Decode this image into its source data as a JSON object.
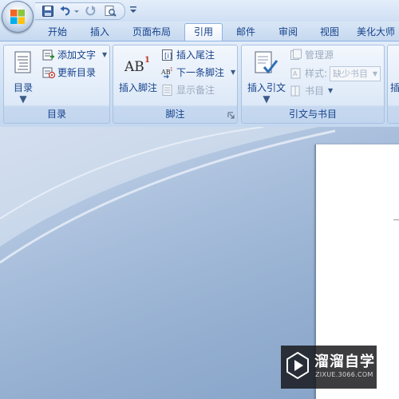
{
  "quick_access": {
    "icons": [
      "save-icon",
      "undo-icon",
      "redo-icon",
      "print-preview-icon",
      "customize-dropdown-icon"
    ]
  },
  "tabs": [
    {
      "label": "开始"
    },
    {
      "label": "插入"
    },
    {
      "label": "页面布局"
    },
    {
      "label": "引用",
      "active": true
    },
    {
      "label": "邮件"
    },
    {
      "label": "审阅"
    },
    {
      "label": "视图"
    },
    {
      "label": "美化大师"
    }
  ],
  "ribbon": {
    "toc_group": {
      "label": "目录",
      "toc_button": "目录",
      "add_text": "添加文字",
      "update_toc": "更新目录"
    },
    "footnote_group": {
      "label": "脚注",
      "insert_footnote": "插入脚注",
      "insert_endnote": "插入尾注",
      "next_footnote": "下一条脚注",
      "show_notes": "显示备注"
    },
    "citation_group": {
      "label": "引文与书目",
      "insert_citation": "插入引文",
      "manage_sources": "管理源",
      "style_label": "样式:",
      "style_value": "缺少书目",
      "bibliography": "书目"
    },
    "overflow_label": "插"
  },
  "watermark": {
    "title": "溜溜自学",
    "url": "ZIXUE.3066.COM"
  },
  "colors": {
    "accent": "#15428b",
    "ribbon_bg": "#dce8f7",
    "workspace": "#9fb6d3"
  }
}
